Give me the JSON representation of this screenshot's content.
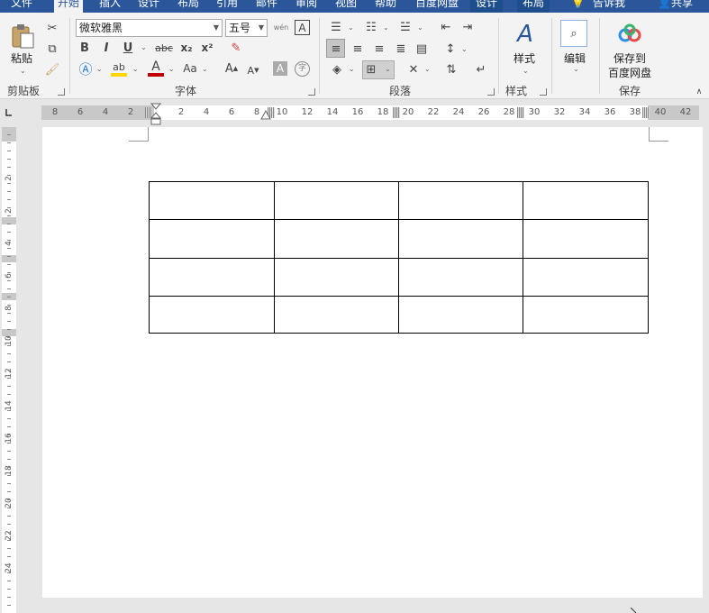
{
  "tabs": [
    {
      "label": "文件",
      "active": false
    },
    {
      "label": "开始",
      "active": true
    },
    {
      "label": "插入",
      "active": false
    },
    {
      "label": "设计",
      "active": false
    },
    {
      "label": "布局",
      "active": false
    },
    {
      "label": "引用",
      "active": false
    },
    {
      "label": "邮件",
      "active": false
    },
    {
      "label": "审阅",
      "active": false
    },
    {
      "label": "视图",
      "active": false
    },
    {
      "label": "帮助",
      "active": false
    },
    {
      "label": "百度网盘",
      "active": false
    },
    {
      "label": "设计",
      "active": false,
      "contextual": true
    },
    {
      "label": "布局",
      "active": false,
      "contextual": true
    }
  ],
  "tell_me": "告诉我",
  "share": "共享",
  "clipboard": {
    "paste_label": "粘贴",
    "group_label": "剪贴板"
  },
  "font": {
    "font_name": "微软雅黑",
    "font_size": "五号",
    "group_label": "字体",
    "bold": "B",
    "italic": "I",
    "underline": "U",
    "strike": "abc",
    "subscript": "x₂",
    "superscript": "x²",
    "grow": "A",
    "shrink": "A",
    "case": "Aa",
    "phonetic": "wén",
    "char_border": "A",
    "char_shading": "A",
    "enclose": "字"
  },
  "paragraph": {
    "group_label": "段落"
  },
  "styles": {
    "button_label": "样式",
    "group_label": "样式"
  },
  "editing": {
    "button_label": "编辑"
  },
  "save": {
    "button_label_1": "保存到",
    "button_label_2": "百度网盘",
    "group_label": "保存"
  },
  "ruler_h_labels": [
    "8",
    "6",
    "4",
    "2",
    "2",
    "4",
    "6",
    "8",
    "10",
    "12",
    "14",
    "16",
    "18",
    "20",
    "22",
    "24",
    "26",
    "28",
    "30",
    "32",
    "34",
    "36",
    "38",
    "40",
    "42"
  ],
  "ruler_v_labels": [
    "2",
    "2",
    "4",
    "6",
    "8",
    "10",
    "12",
    "14",
    "16",
    "18",
    "20",
    "22",
    "24"
  ],
  "table": {
    "rows": 4,
    "cols": 4,
    "cells": [
      [
        "",
        "",
        "",
        ""
      ],
      [
        "",
        "",
        "",
        ""
      ],
      [
        "",
        "",
        "",
        ""
      ],
      [
        "",
        "",
        "",
        ""
      ]
    ]
  },
  "colors": {
    "accent": "#2b579a",
    "ribbon_bg": "#f3f3f3",
    "workspace_bg": "#e6e6e6",
    "highlight_yellow": "#ffd700",
    "font_red": "#c00000"
  }
}
